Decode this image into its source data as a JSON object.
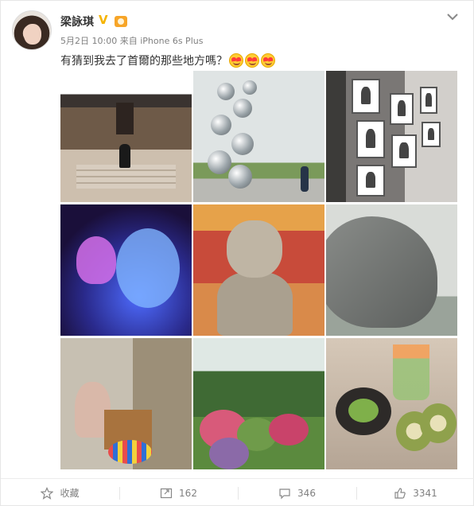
{
  "post": {
    "author_name": "梁詠琪",
    "date": "5月2日 10:00",
    "source_prefix": "来自",
    "source": "iPhone 6s Plus",
    "text": "有猜到我去了首爾的那些地方嗎？",
    "emoji_count": 3
  },
  "actions": {
    "favorite_label": "收藏",
    "repost_count": "162",
    "comment_count": "346",
    "like_count": "3341"
  },
  "colors": {
    "verified_badge": "#f5b400",
    "muted_text": "#808080"
  },
  "icons": [
    "chevron-down-icon",
    "verified-v-icon",
    "member-crown-icon",
    "star-icon",
    "repost-icon",
    "comment-icon",
    "thumbs-up-icon"
  ]
}
